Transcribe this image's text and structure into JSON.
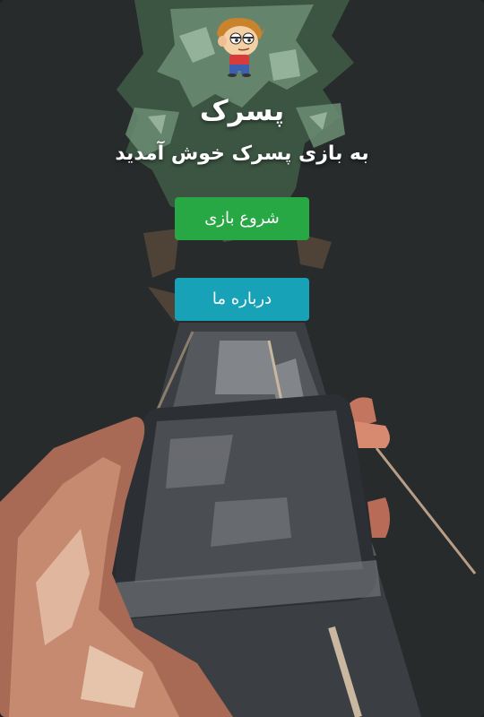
{
  "game": {
    "title": "پسرک",
    "welcome_message": "به بازی پسرک خوش آمدید"
  },
  "menu": {
    "start_label": "شروع بازی",
    "about_label": "درباره ما"
  },
  "colors": {
    "start_button": "#28a745",
    "about_button": "#17a2b8",
    "background": "#272b2c",
    "text": "#ffffff"
  },
  "icons": {
    "mascot": "cartoon-boy-icon"
  }
}
